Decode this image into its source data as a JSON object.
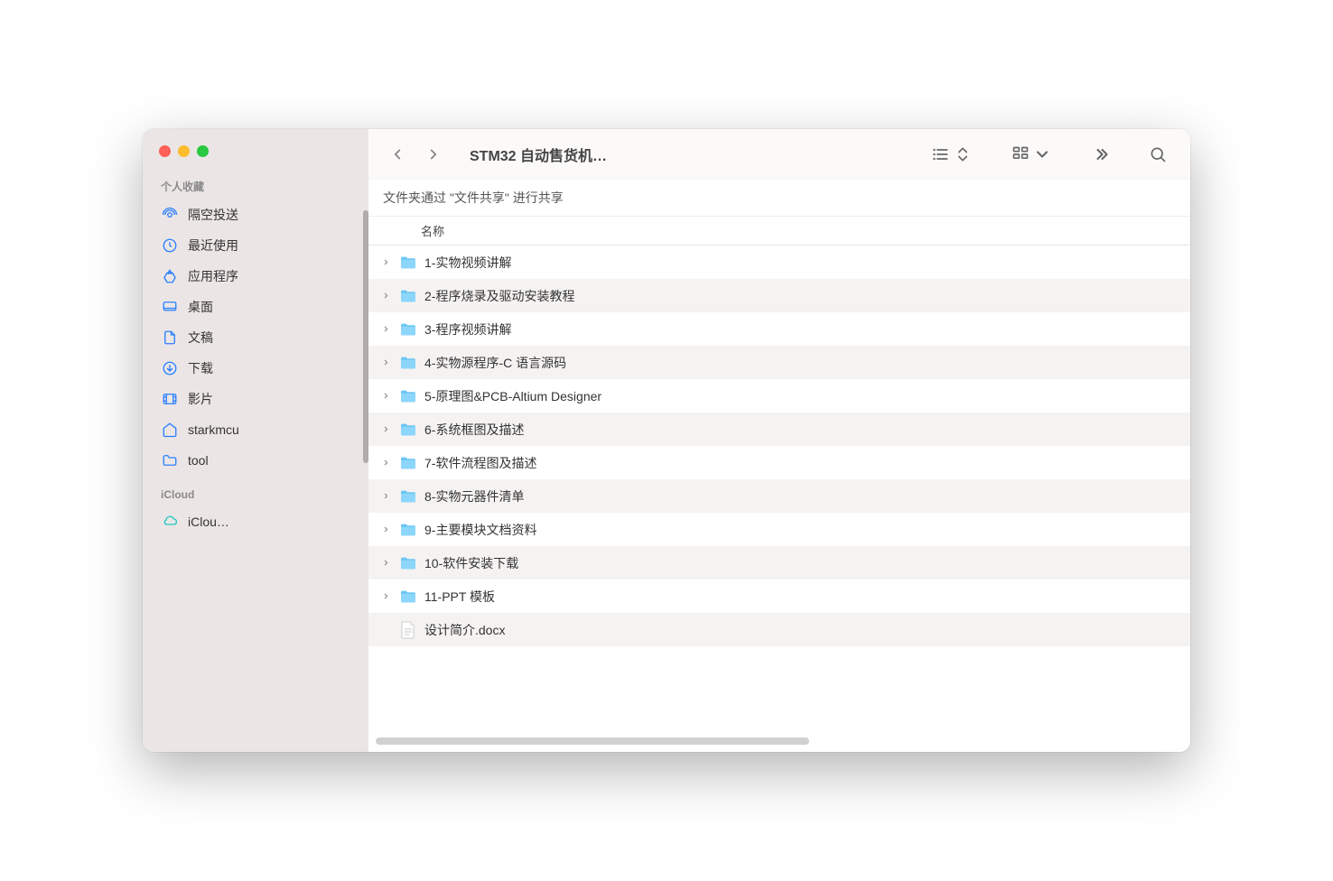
{
  "window": {
    "title": "STM32 自动售货机…"
  },
  "sidebar": {
    "sections": [
      {
        "header": "个人收藏",
        "items": [
          {
            "icon": "airdrop",
            "label": "隔空投送"
          },
          {
            "icon": "clock",
            "label": "最近使用"
          },
          {
            "icon": "apps",
            "label": "应用程序"
          },
          {
            "icon": "desktop",
            "label": "桌面"
          },
          {
            "icon": "document",
            "label": "文稿"
          },
          {
            "icon": "download",
            "label": "下载"
          },
          {
            "icon": "film",
            "label": "影片"
          },
          {
            "icon": "home",
            "label": "starkmcu"
          },
          {
            "icon": "folder",
            "label": "tool"
          }
        ]
      },
      {
        "header": "iCloud",
        "items": [
          {
            "icon": "cloud",
            "label": "iClou…"
          }
        ]
      }
    ]
  },
  "infoBar": "文件夹通过 \"文件共享\" 进行共享",
  "columnHeader": "名称",
  "files": [
    {
      "type": "folder",
      "name": "1-实物视频讲解"
    },
    {
      "type": "folder",
      "name": "2-程序烧录及驱动安装教程"
    },
    {
      "type": "folder",
      "name": "3-程序视频讲解"
    },
    {
      "type": "folder",
      "name": "4-实物源程序-C 语言源码"
    },
    {
      "type": "folder",
      "name": "5-原理图&PCB-Altium Designer"
    },
    {
      "type": "folder",
      "name": "6-系统框图及描述"
    },
    {
      "type": "folder",
      "name": "7-软件流程图及描述"
    },
    {
      "type": "folder",
      "name": "8-实物元器件清单"
    },
    {
      "type": "folder",
      "name": "9-主要模块文档资料"
    },
    {
      "type": "folder",
      "name": "10-软件安装下载"
    },
    {
      "type": "folder",
      "name": "11-PPT 模板"
    },
    {
      "type": "doc",
      "name": "设计简介.docx"
    }
  ]
}
